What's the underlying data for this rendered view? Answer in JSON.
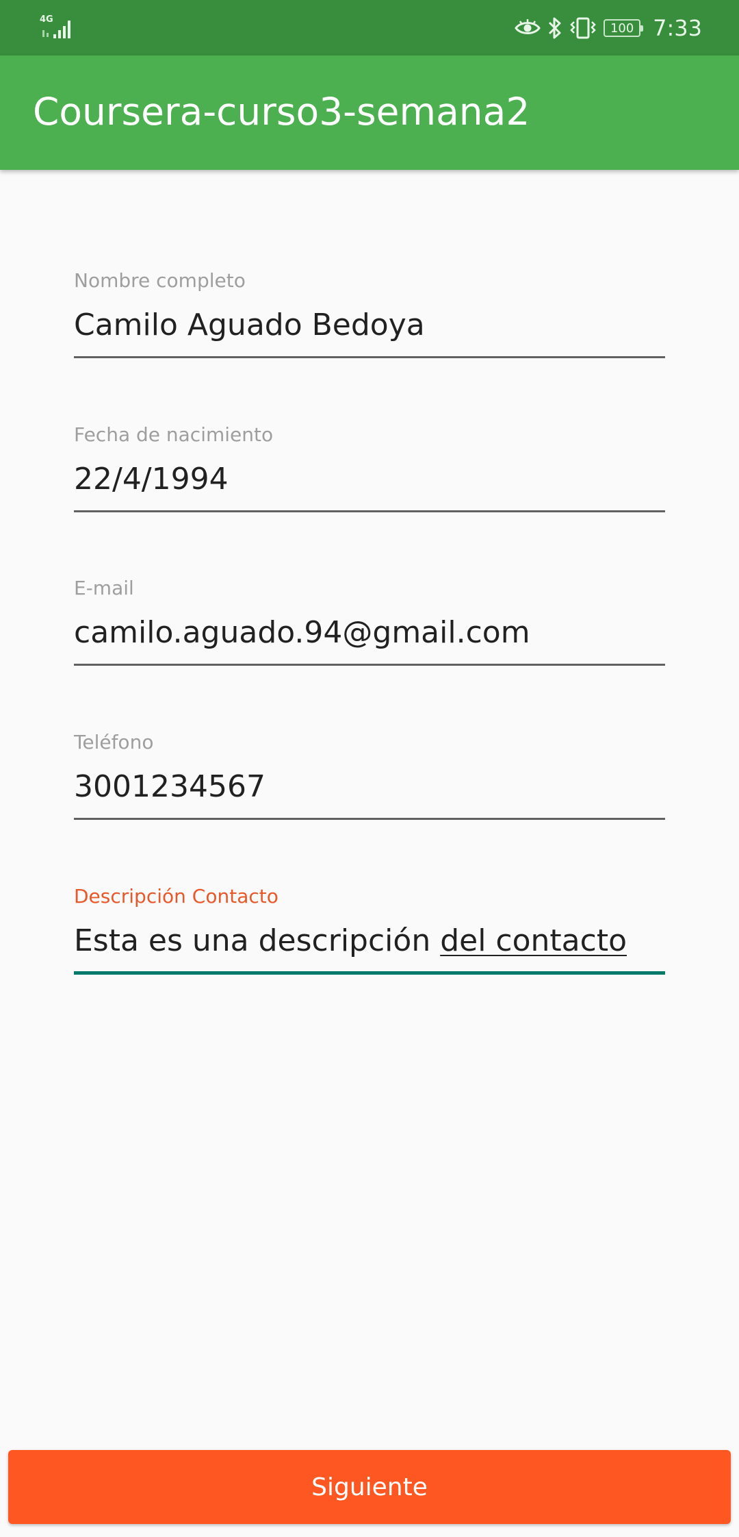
{
  "status_bar": {
    "network_label": "4G",
    "icons": [
      "eye-icon",
      "bluetooth-icon",
      "vibrate-icon"
    ],
    "battery_level": "100",
    "time": "7:33"
  },
  "app_bar": {
    "title": "Coursera-curso3-semana2"
  },
  "form": {
    "full_name": {
      "label": "Nombre completo",
      "value": "Camilo Aguado Bedoya"
    },
    "birth_date": {
      "label": "Fecha de nacimiento",
      "value": "22/4/1994"
    },
    "email": {
      "label": "E-mail",
      "value": "camilo.aguado.94@gmail.com"
    },
    "phone": {
      "label": "Teléfono",
      "value": "3001234567"
    },
    "description": {
      "label": "Descripción Contacto",
      "value_part1": "Esta es una descripción ",
      "value_part2": "del contacto"
    }
  },
  "next_button": {
    "label": "Siguiente"
  },
  "colors": {
    "status_bar": "#388e3c",
    "app_bar": "#4caf50",
    "accent_label": "#e8582a",
    "focus_line": "#00796b",
    "button": "#ff5722"
  }
}
